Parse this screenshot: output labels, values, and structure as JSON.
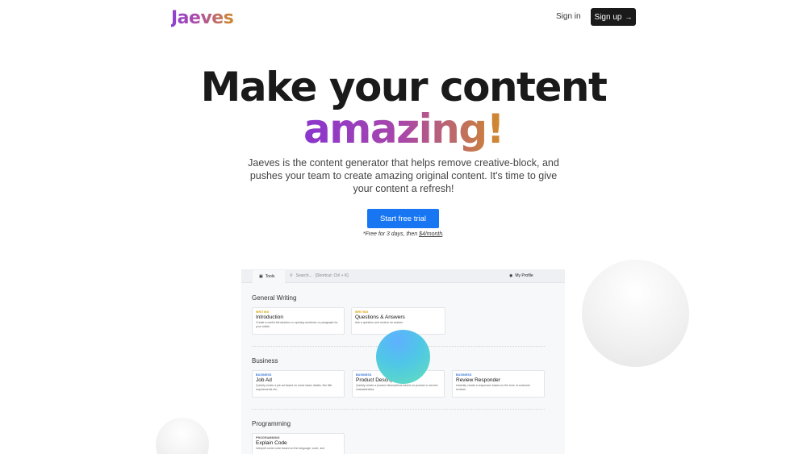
{
  "header": {
    "logo": "Jaeves",
    "sign_in": "Sign in",
    "sign_up": "Sign up",
    "sign_up_icon": "→"
  },
  "hero": {
    "title_line1": "Make your content",
    "title_line2": "amazing!",
    "subtitle": "Jaeves is the content generator that helps remove creative-block, and pushes your team to create amazing original content. It's time to give your content a refresh!",
    "cta": "Start free trial",
    "note_prefix": "*Free for 3 days, then ",
    "note_price": "$4/month",
    "note_suffix": "."
  },
  "preview": {
    "tools_tab": "Tools",
    "search_placeholder": "Search...",
    "search_shortcut": "[Shortcut: Ctrl + K]",
    "profile": "My Profile",
    "sections": [
      {
        "title": "General Writing",
        "cards": [
          {
            "tag": "Writing",
            "name": "Introduction",
            "desc": "Create a useful introduction or opening sentence or paragraph for your article."
          },
          {
            "tag": "Writing",
            "name": "Questions & Answers",
            "desc": "Ask a question and receive an answer."
          }
        ]
      },
      {
        "title": "Business",
        "cards": [
          {
            "tag": "Business",
            "name": "Job Ad",
            "desc": "Quickly create a job ad based on some basic details, like title requirements etc."
          },
          {
            "tag": "Business",
            "name": "Product Description",
            "desc": "Quickly create a product descriptions based on product or service characteristics."
          },
          {
            "tag": "Business",
            "name": "Review Responder",
            "desc": "Instantly create a responses based on the tone of customer reviews."
          }
        ]
      },
      {
        "title": "Programming",
        "cards": [
          {
            "tag": "Programming",
            "name": "Explain Code",
            "desc": "Interpret some code based on the language, code, and"
          }
        ]
      }
    ]
  },
  "colors": {
    "cta": "#1876f2",
    "accent_purple": "#8a35cf",
    "accent_orange": "#d18a2b"
  }
}
